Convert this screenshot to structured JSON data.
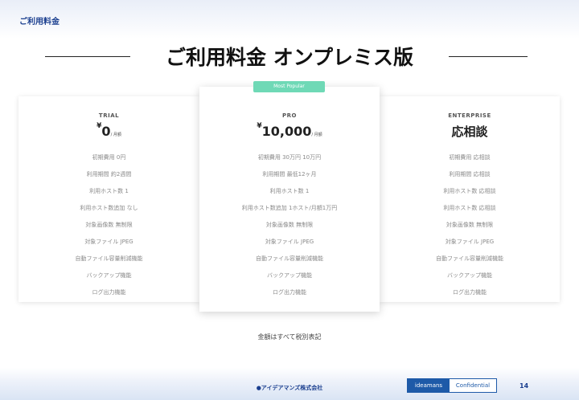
{
  "header": {
    "corner_title": "ご利用料金"
  },
  "title": "ご利用料金 オンプレミス版",
  "plans": [
    {
      "name": "TRIAL",
      "price_prefix": "¥",
      "price": "0",
      "unit": "/ 月額",
      "features": [
        "初期費用 0円",
        "利用期間 約2週間",
        "利用ホスト数 1",
        "利用ホスト数追加 なし",
        "対象画像数 無制限",
        "対象ファイル JPEG",
        "自動ファイル容量削減機能",
        "バックアップ機能",
        "ログ出力機能"
      ]
    },
    {
      "name": "PRO",
      "badge": "Most Popular",
      "price_prefix": "¥",
      "price": "10,000",
      "unit": "/ 月額",
      "features": [
        "初期費用 30万円 10万円",
        "利用期間 最低12ヶ月",
        "利用ホスト数 1",
        "利用ホスト数追加 1ホスト/月額1万円",
        "対象画像数 無制限",
        "対象ファイル JPEG",
        "自動ファイル容量削減機能",
        "バックアップ機能",
        "ログ出力機能"
      ]
    },
    {
      "name": "ENTERPRISE",
      "price_prefix": "",
      "price": "応相談",
      "unit": "",
      "features": [
        "初期費用 応相談",
        "利用期間 応相談",
        "利用ホスト数 応相談",
        "利用ホスト数 応相談",
        "対象画像数 無制限",
        "対象ファイル JPEG",
        "自動ファイル容量削減機能",
        "バックアップ機能",
        "ログ出力機能"
      ]
    }
  ],
  "note": "金額はすべて税別表記",
  "footer": {
    "company": "●アイデアマンズ株式会社",
    "brand": "ideamans",
    "confidential": "Confidential",
    "page": "14"
  }
}
